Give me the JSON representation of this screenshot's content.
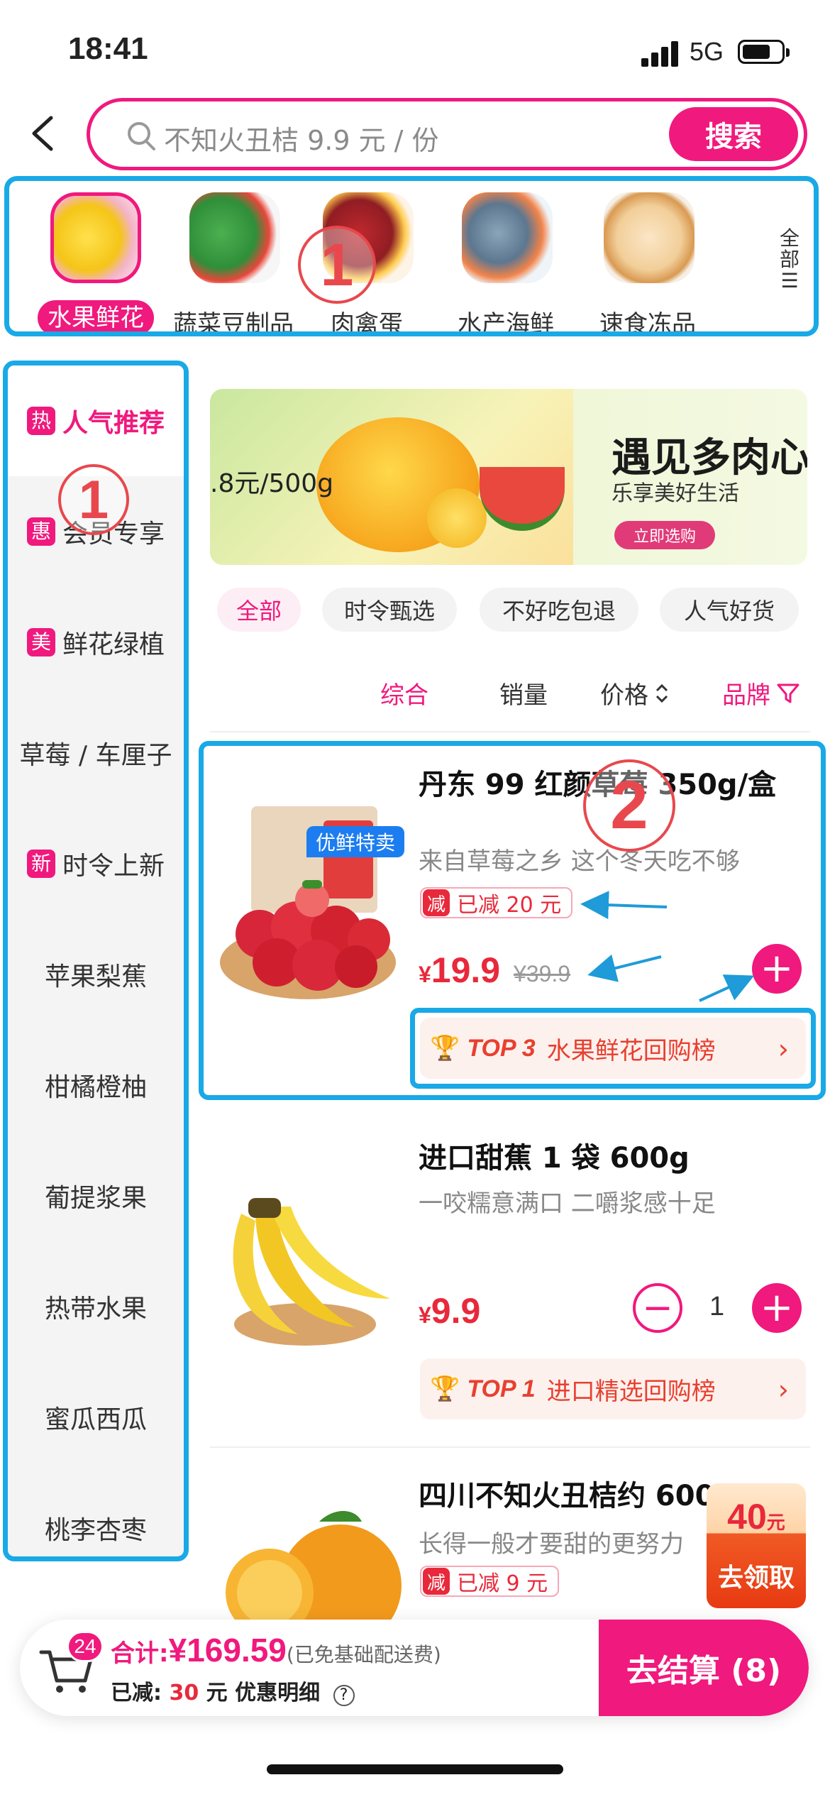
{
  "status_bar": {
    "time": "18:41",
    "network": "5G"
  },
  "search": {
    "placeholder": "不知火丑桔 9.9 元 / 份",
    "button_label": "搜索"
  },
  "top_categories": {
    "items": [
      {
        "label": "水果鲜花",
        "icon": "banana-flower-icon",
        "active": true
      },
      {
        "label": "蔬菜豆制品",
        "icon": "vegetable-icon",
        "active": false
      },
      {
        "label": "肉禽蛋",
        "icon": "meat-egg-icon",
        "active": false
      },
      {
        "label": "水产海鲜",
        "icon": "seafood-icon",
        "active": false
      },
      {
        "label": "速食冻品",
        "icon": "frozen-food-icon",
        "active": false
      }
    ],
    "all_label": "全部"
  },
  "annotations": {
    "circle_1": "1",
    "circle_2": "2"
  },
  "sidebar": {
    "items": [
      {
        "tag": "热",
        "label": "人气推荐",
        "active": true
      },
      {
        "tag": "惠",
        "label": "会员专享",
        "active": false
      },
      {
        "tag": "美",
        "label": "鲜花绿植",
        "active": false
      },
      {
        "tag": "",
        "label": "草莓 / 车厘子",
        "active": false
      },
      {
        "tag": "新",
        "label": "时令上新",
        "active": false
      },
      {
        "tag": "",
        "label": "苹果梨蕉",
        "active": false
      },
      {
        "tag": "",
        "label": "柑橘橙柚",
        "active": false
      },
      {
        "tag": "",
        "label": "葡提浆果",
        "active": false
      },
      {
        "tag": "",
        "label": "热带水果",
        "active": false
      },
      {
        "tag": "",
        "label": "蜜瓜西瓜",
        "active": false
      },
      {
        "tag": "",
        "label": "桃李杏枣",
        "active": false
      }
    ]
  },
  "banner": {
    "price_text": ".8元/500g",
    "title": "遇见多肉心",
    "subtitle": "乐享美好生活",
    "button_label": "立即选购"
  },
  "filter_chips": [
    {
      "label": "全部",
      "active": true
    },
    {
      "label": "时令甄选",
      "active": false
    },
    {
      "label": "不好吃包退",
      "active": false
    },
    {
      "label": "人气好货",
      "active": false
    }
  ],
  "sort": {
    "composite": "综合",
    "sales": "销量",
    "price": "价格",
    "brand": "品牌"
  },
  "products": [
    {
      "name": "丹东 99 红颜草莓 350g/盒",
      "desc": "来自草莓之乡 这个冬天吃不够",
      "tag_badge": "减",
      "tag_text": "已减 20 元",
      "currency": "¥",
      "price": "19.9",
      "original_price": "¥39.9",
      "image_badge": "优鲜特卖",
      "rank_top": "TOP 3",
      "rank_label": "水果鲜花回购榜"
    },
    {
      "name": "进口甜蕉 1 袋 600g",
      "desc": "一咬糯意满口 二嚼浆感十足",
      "currency": "¥",
      "price": "9.9",
      "quantity": "1",
      "rank_top": "TOP 1",
      "rank_label": "进口精选回购榜"
    },
    {
      "name": "四川不知火丑桔约 600g",
      "desc": "长得一般才要甜的更努力",
      "tag_badge": "减",
      "tag_text": "已减 9 元"
    }
  ],
  "coupon": {
    "amount": "40",
    "unit": "元",
    "label": "去领取"
  },
  "cart": {
    "badge_count": "24",
    "total_label": "合计:",
    "total_amount": "¥169.59",
    "total_note": "(已免基础配送费)",
    "saved_label": "已减:",
    "saved_amount": "30",
    "saved_unit": "元",
    "detail_label": "优惠明细",
    "help_glyph": "?",
    "checkout_label": "去结算 (8)"
  },
  "colors": {
    "accent": "#f0197d",
    "annotation_blue": "#19a9e6",
    "price_red": "#e8293b"
  }
}
